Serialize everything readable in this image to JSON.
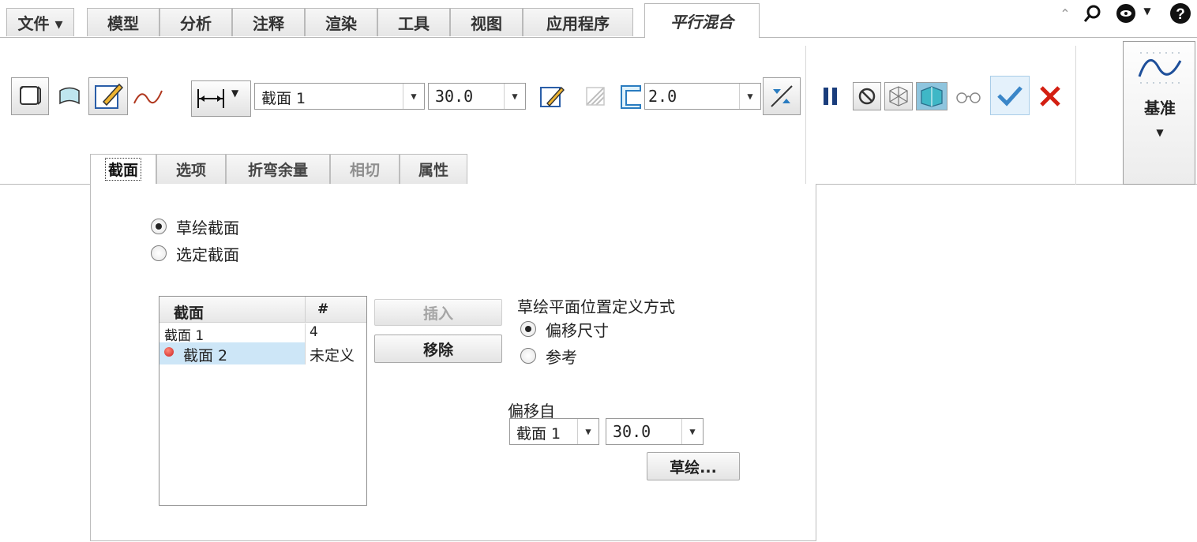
{
  "menu": {
    "tabs": [
      {
        "label": "文件 ▾"
      },
      {
        "label": "模型"
      },
      {
        "label": "分析"
      },
      {
        "label": "注释"
      },
      {
        "label": "渲染"
      },
      {
        "label": "工具"
      },
      {
        "label": "视图"
      },
      {
        "label": "应用程序"
      },
      {
        "label": "平行混合"
      }
    ]
  },
  "ribbon": {
    "section_combo": {
      "value": "截面 1"
    },
    "depth_combo": {
      "value": "30.0"
    },
    "thickness_combo": {
      "value": "2.0"
    },
    "datum_label": "基准"
  },
  "subtabs": [
    {
      "label": "截面"
    },
    {
      "label": "选项"
    },
    {
      "label": "折弯余量"
    },
    {
      "label": "相切"
    },
    {
      "label": "属性"
    }
  ],
  "panel": {
    "radio_sketch": "草绘截面",
    "radio_select": "选定截面",
    "table": {
      "headers": [
        "截面",
        "#"
      ],
      "rows": [
        {
          "name": "截面 1",
          "value": "4"
        },
        {
          "name": "截面 2",
          "value": "未定义"
        }
      ]
    },
    "insert_label": "插入",
    "remove_label": "移除",
    "plane_group_title": "草绘平面位置定义方式",
    "radio_offset": "偏移尺寸",
    "radio_reference": "参考",
    "offset_from_label": "偏移自",
    "offset_section_combo": "截面 1",
    "offset_value_combo": "30.0",
    "sketch_button": "草绘..."
  },
  "colors": {
    "accept": "#3a86c8",
    "cancel": "#d31f12",
    "selected_row": "#cde6f7",
    "status_dot": "#cc2020"
  }
}
